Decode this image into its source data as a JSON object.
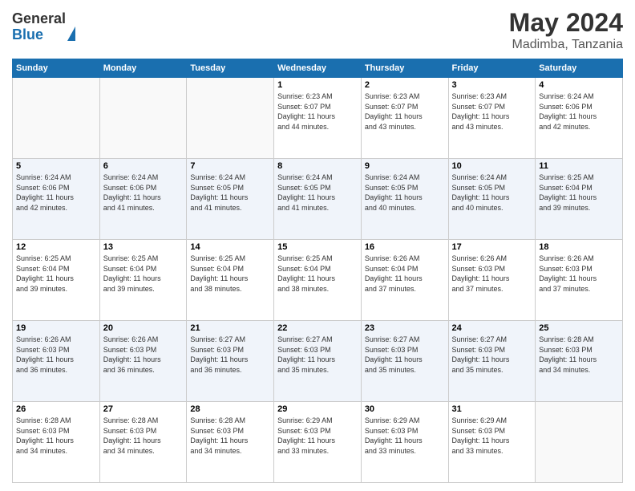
{
  "header": {
    "logo_line1": "General",
    "logo_line2": "Blue",
    "month_year": "May 2024",
    "location": "Madimba, Tanzania"
  },
  "days_of_week": [
    "Sunday",
    "Monday",
    "Tuesday",
    "Wednesday",
    "Thursday",
    "Friday",
    "Saturday"
  ],
  "weeks": [
    [
      {
        "day": "",
        "info": ""
      },
      {
        "day": "",
        "info": ""
      },
      {
        "day": "",
        "info": ""
      },
      {
        "day": "1",
        "info": "Sunrise: 6:23 AM\nSunset: 6:07 PM\nDaylight: 11 hours\nand 44 minutes."
      },
      {
        "day": "2",
        "info": "Sunrise: 6:23 AM\nSunset: 6:07 PM\nDaylight: 11 hours\nand 43 minutes."
      },
      {
        "day": "3",
        "info": "Sunrise: 6:23 AM\nSunset: 6:07 PM\nDaylight: 11 hours\nand 43 minutes."
      },
      {
        "day": "4",
        "info": "Sunrise: 6:24 AM\nSunset: 6:06 PM\nDaylight: 11 hours\nand 42 minutes."
      }
    ],
    [
      {
        "day": "5",
        "info": "Sunrise: 6:24 AM\nSunset: 6:06 PM\nDaylight: 11 hours\nand 42 minutes."
      },
      {
        "day": "6",
        "info": "Sunrise: 6:24 AM\nSunset: 6:06 PM\nDaylight: 11 hours\nand 41 minutes."
      },
      {
        "day": "7",
        "info": "Sunrise: 6:24 AM\nSunset: 6:05 PM\nDaylight: 11 hours\nand 41 minutes."
      },
      {
        "day": "8",
        "info": "Sunrise: 6:24 AM\nSunset: 6:05 PM\nDaylight: 11 hours\nand 41 minutes."
      },
      {
        "day": "9",
        "info": "Sunrise: 6:24 AM\nSunset: 6:05 PM\nDaylight: 11 hours\nand 40 minutes."
      },
      {
        "day": "10",
        "info": "Sunrise: 6:24 AM\nSunset: 6:05 PM\nDaylight: 11 hours\nand 40 minutes."
      },
      {
        "day": "11",
        "info": "Sunrise: 6:25 AM\nSunset: 6:04 PM\nDaylight: 11 hours\nand 39 minutes."
      }
    ],
    [
      {
        "day": "12",
        "info": "Sunrise: 6:25 AM\nSunset: 6:04 PM\nDaylight: 11 hours\nand 39 minutes."
      },
      {
        "day": "13",
        "info": "Sunrise: 6:25 AM\nSunset: 6:04 PM\nDaylight: 11 hours\nand 39 minutes."
      },
      {
        "day": "14",
        "info": "Sunrise: 6:25 AM\nSunset: 6:04 PM\nDaylight: 11 hours\nand 38 minutes."
      },
      {
        "day": "15",
        "info": "Sunrise: 6:25 AM\nSunset: 6:04 PM\nDaylight: 11 hours\nand 38 minutes."
      },
      {
        "day": "16",
        "info": "Sunrise: 6:26 AM\nSunset: 6:04 PM\nDaylight: 11 hours\nand 37 minutes."
      },
      {
        "day": "17",
        "info": "Sunrise: 6:26 AM\nSunset: 6:03 PM\nDaylight: 11 hours\nand 37 minutes."
      },
      {
        "day": "18",
        "info": "Sunrise: 6:26 AM\nSunset: 6:03 PM\nDaylight: 11 hours\nand 37 minutes."
      }
    ],
    [
      {
        "day": "19",
        "info": "Sunrise: 6:26 AM\nSunset: 6:03 PM\nDaylight: 11 hours\nand 36 minutes."
      },
      {
        "day": "20",
        "info": "Sunrise: 6:26 AM\nSunset: 6:03 PM\nDaylight: 11 hours\nand 36 minutes."
      },
      {
        "day": "21",
        "info": "Sunrise: 6:27 AM\nSunset: 6:03 PM\nDaylight: 11 hours\nand 36 minutes."
      },
      {
        "day": "22",
        "info": "Sunrise: 6:27 AM\nSunset: 6:03 PM\nDaylight: 11 hours\nand 35 minutes."
      },
      {
        "day": "23",
        "info": "Sunrise: 6:27 AM\nSunset: 6:03 PM\nDaylight: 11 hours\nand 35 minutes."
      },
      {
        "day": "24",
        "info": "Sunrise: 6:27 AM\nSunset: 6:03 PM\nDaylight: 11 hours\nand 35 minutes."
      },
      {
        "day": "25",
        "info": "Sunrise: 6:28 AM\nSunset: 6:03 PM\nDaylight: 11 hours\nand 34 minutes."
      }
    ],
    [
      {
        "day": "26",
        "info": "Sunrise: 6:28 AM\nSunset: 6:03 PM\nDaylight: 11 hours\nand 34 minutes."
      },
      {
        "day": "27",
        "info": "Sunrise: 6:28 AM\nSunset: 6:03 PM\nDaylight: 11 hours\nand 34 minutes."
      },
      {
        "day": "28",
        "info": "Sunrise: 6:28 AM\nSunset: 6:03 PM\nDaylight: 11 hours\nand 34 minutes."
      },
      {
        "day": "29",
        "info": "Sunrise: 6:29 AM\nSunset: 6:03 PM\nDaylight: 11 hours\nand 33 minutes."
      },
      {
        "day": "30",
        "info": "Sunrise: 6:29 AM\nSunset: 6:03 PM\nDaylight: 11 hours\nand 33 minutes."
      },
      {
        "day": "31",
        "info": "Sunrise: 6:29 AM\nSunset: 6:03 PM\nDaylight: 11 hours\nand 33 minutes."
      },
      {
        "day": "",
        "info": ""
      }
    ]
  ]
}
